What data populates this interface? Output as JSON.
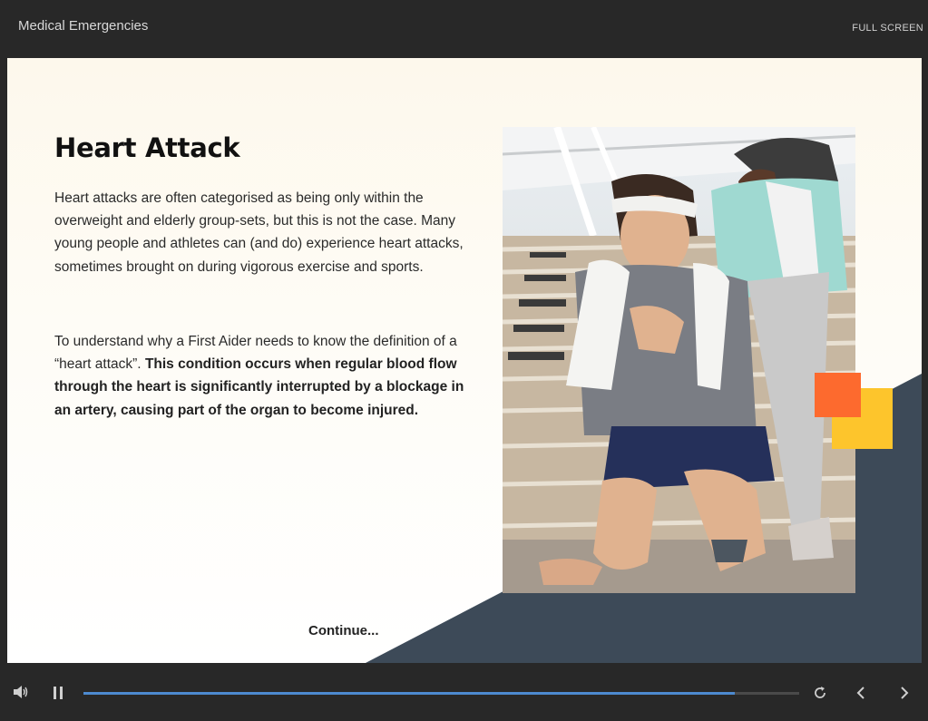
{
  "header": {
    "course_title": "Medical Emergencies",
    "fullscreen_label": "FULL SCREEN"
  },
  "slide": {
    "heading": "Heart Attack",
    "para1": "Heart attacks are often categorised as being only within the overweight and elderly group-sets, but this is not the case. Many young people and athletes can (and do) experience heart attacks, sometimes brought on during vigorous exercise and sports.",
    "para2_intro": "To understand why a First Aider needs to know the definition of a “heart attack”. ",
    "para2_bold": "This condition occurs when regular blood flow through the heart is significantly interrupted by a blockage in an artery, causing part of the organ to become injured.",
    "continue_label": "Continue...",
    "image_icon": "photo-woman-chest-pain-on-stairs"
  },
  "player": {
    "progress_fraction": 0.91,
    "icons": [
      "volume-icon",
      "pause-icon",
      "replay-icon",
      "chevron-left-icon",
      "chevron-right-icon"
    ]
  },
  "colors": {
    "chrome": "#282828",
    "accent_progress": "#4d8ad0",
    "dark_shape": "#3d4a58",
    "orange": "#fd6a2e",
    "yellow": "#fdc52c"
  }
}
